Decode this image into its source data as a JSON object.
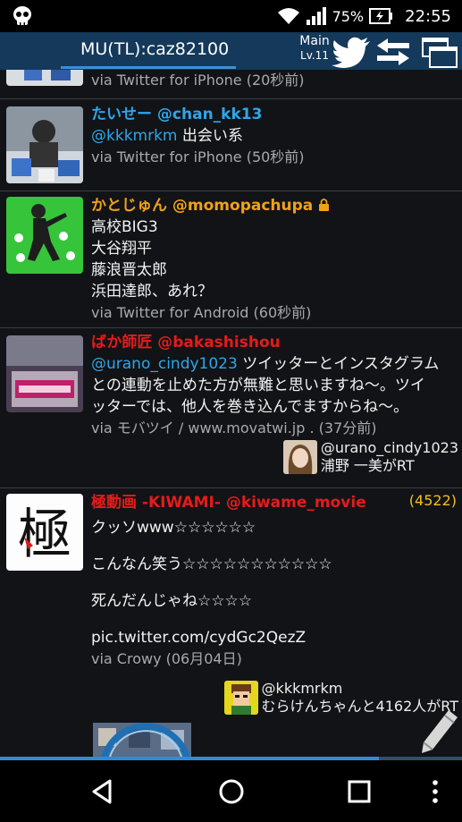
{
  "status_bar": {
    "battery": "75%",
    "time": "22:55"
  },
  "header": {
    "title": "MU(TL):caz82100",
    "level_main": "Main",
    "level_lv": "Lv.11"
  },
  "partial_top": {
    "via_text": "via Twitter for iPhone (20秒前)"
  },
  "tweets": [
    {
      "user": "たいせー @chan_kk13",
      "mention": "@kkkmrkm",
      "text": " 出会い系",
      "via": "via Twitter for iPhone (50秒前)"
    },
    {
      "user": "かとじゅん @momopachupa",
      "lines": [
        "高校BIG3",
        "大谷翔平",
        "藤浪晋太郎",
        "浜田達郎、あれ？"
      ],
      "via": "via Twitter for Android (60秒前)"
    },
    {
      "user": "ばか師匠 @bakashishou",
      "mention": "@urano_cindy1023",
      "line1_rest": " ツイッターとインスタグラム",
      "line2": "との連動を止めた方が無難と思いますね〜。ツイ",
      "line3": "ッターでは、他人を巻き込んでますからね〜。",
      "via": "via モバツイ / www.movatwi.jp . (37分前)",
      "rt_handle": "@urano_cindy1023",
      "rt_text": "浦野 一美がRT"
    },
    {
      "user": "極動画 -KIWAMI- @kiwame_movie",
      "count": "(4522)",
      "lines": [
        "クッソwww☆☆☆☆☆☆",
        "こんなん笑う☆☆☆☆☆☆☆☆☆☆☆",
        "死んだんじゃね☆☆☆☆",
        "pic.twitter.com/cydGc2QezZ"
      ],
      "via": "via Crowy (06月04日)",
      "rt_handle": "@kkkmrkm",
      "rt_text": "むらけんちゃんと4162人がRT"
    }
  ],
  "progress_fraction": 0.82,
  "colors": {
    "header_bg": "#14395a",
    "accent_blue": "#2fa6ea",
    "orange": "#f1a119",
    "red": "#e51b1b"
  }
}
